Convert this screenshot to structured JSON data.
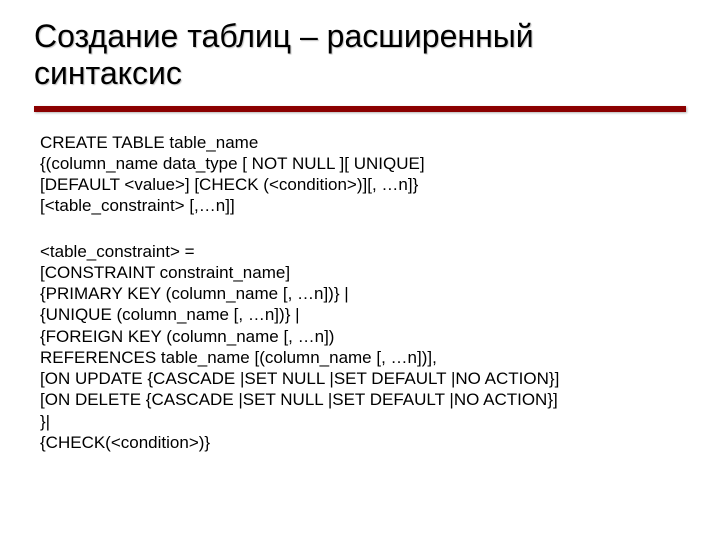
{
  "slide": {
    "title": "Создание таблиц – расширенный синтаксис",
    "block1": "CREATE TABLE table_name\n{(column_name data_type [ NOT NULL ][ UNIQUE]\n[DEFAULT <value>] [CHECK (<condition>)][, …n]}\n[<table_constraint> [,…n]]",
    "block2": "<table_constraint> =\n[CONSTRAINT constraint_name]\n{PRIMARY KEY (column_name [, …n])} |\n{UNIQUE (column_name [, …n])} |\n{FOREIGN KEY (column_name [, …n])\nREFERENCES table_name [(column_name [, …n])],\n[ON UPDATE {CASCADE |SET NULL |SET DEFAULT |NO ACTION}]\n[ON DELETE {CASCADE |SET NULL |SET DEFAULT |NO ACTION}]\n}|\n{CHECK(<condition>)}"
  }
}
